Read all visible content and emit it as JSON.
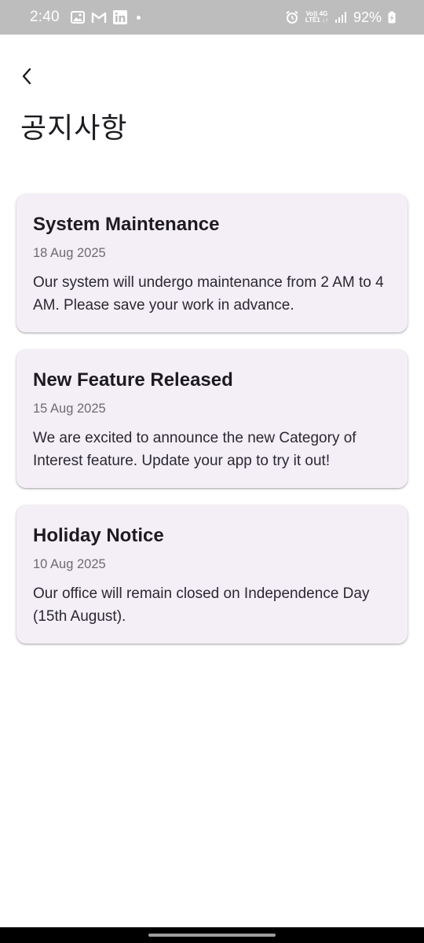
{
  "status_bar": {
    "time": "2:40",
    "left_icons": [
      "gallery-icon",
      "gmail-icon",
      "linkedin-icon"
    ],
    "network_top": "Vo)) 4G",
    "network_bottom": "LTE1 ↓↑",
    "battery": "92%"
  },
  "header": {
    "back_icon": "chevron-left-icon",
    "title": "공지사항"
  },
  "notices": [
    {
      "title": "System Maintenance",
      "date": "18 Aug 2025",
      "body": "Our system will undergo maintenance from 2 AM to 4 AM. Please save your work in advance."
    },
    {
      "title": "New Feature Released",
      "date": "15 Aug 2025",
      "body": "We are excited to announce the new Category of Interest feature. Update your app to try it out!"
    },
    {
      "title": "Holiday Notice",
      "date": "10 Aug 2025",
      "body": "Our office will remain closed on Independence Day (15th August)."
    }
  ],
  "colors": {
    "status_bar_bg": "#bdbdbd",
    "card_bg": "#f4eff7",
    "title_text": "#1d1b20",
    "date_text": "#6d6a72"
  }
}
